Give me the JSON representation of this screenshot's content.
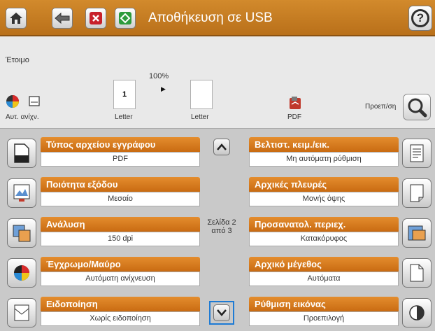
{
  "titlebar": {
    "title": "Αποθήκευση σε USB",
    "help_label": "?"
  },
  "preview": {
    "status": "Έτοιμο",
    "zoom": "100%",
    "auto_color_label": "Αυτ. ανίχν.",
    "page_number": "1",
    "page1_size": "Letter",
    "page2_size": "Letter",
    "format_label": "PDF",
    "preview_label": "Προεπ/ση"
  },
  "options": {
    "left": [
      {
        "title": "Τύπος αρχείου εγγράφου",
        "value": "PDF"
      },
      {
        "title": "Ποιότητα εξόδου",
        "value": "Μεσαίο"
      },
      {
        "title": "Ανάλυση",
        "value": "150 dpi"
      },
      {
        "title": "Έγχρωμο/Μαύρο",
        "value": "Αυτόματη ανίχνευση"
      },
      {
        "title": "Ειδοποίηση",
        "value": "Χωρίς ειδοποίηση"
      }
    ],
    "right": [
      {
        "title": "Βελτιστ. κειμ./εικ.",
        "value": "Μη αυτόματη ρύθμιση"
      },
      {
        "title": "Αρχικές πλευρές",
        "value": "Μονής όψης"
      },
      {
        "title": "Προσανατολ. περιεχ.",
        "value": "Κατακόρυφος"
      },
      {
        "title": "Αρχικό μέγεθος",
        "value": "Αυτόματα"
      },
      {
        "title": "Ρύθμιση εικόνας",
        "value": "Προεπιλογή"
      }
    ]
  },
  "pagination": {
    "line1": "Σελίδα 2",
    "line2": "από 3"
  },
  "colors": {
    "accent": "#d8801f",
    "header_orange": "#c96b12",
    "selection_blue": "#1e7bd4"
  }
}
